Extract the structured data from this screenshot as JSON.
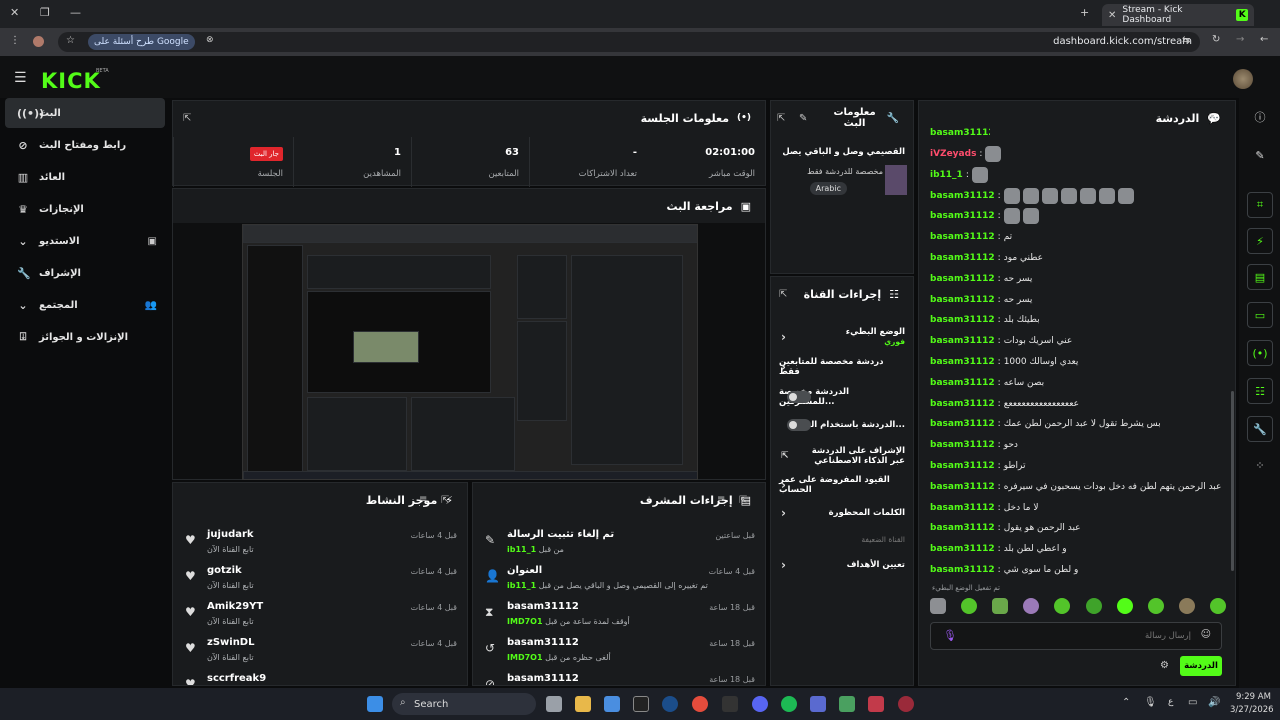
{
  "browser": {
    "tab_title": "Stream - Kick Dashboard",
    "url": "dashboard.kick.com/stream",
    "google_pill": "طرح أسئلة على Google"
  },
  "brand": {
    "logo": "KICK",
    "beta": "BETA"
  },
  "sidebar": {
    "items": [
      {
        "label": "البث",
        "icon": "broadcast-icon"
      },
      {
        "label": "رابط ومفتاح البث",
        "icon": "link-icon"
      },
      {
        "label": "العائد",
        "icon": "chart-icon"
      },
      {
        "label": "الإنجازات",
        "icon": "trophy-icon"
      },
      {
        "label": "الاستديو",
        "icon": "chevron-down-icon"
      },
      {
        "label": "الإشراف",
        "icon": "wrench-icon"
      },
      {
        "label": "المجتمع",
        "icon": "chevron-down-icon"
      },
      {
        "label": "الإنزالات و الجوائز",
        "icon": "gift-icon"
      }
    ]
  },
  "session": {
    "title": "معلومات الجلسة",
    "live_badge": "جار البث",
    "stats": [
      {
        "value": "",
        "label": "الجلسة"
      },
      {
        "value": "1",
        "label": "المشاهدين"
      },
      {
        "value": "63",
        "label": "المتابعين"
      },
      {
        "value": "-",
        "label": "تعداد الاشتراكات"
      },
      {
        "value": "02:01:00",
        "label": "الوقت مباشر"
      }
    ]
  },
  "preview": {
    "title": "مراجعة البث"
  },
  "stream_info": {
    "title": "معلومات البث",
    "stream_title": "القصيمي وصل و الباقي يصل",
    "subtitle": "مخصصة للدردشة فقط",
    "language": "Arabic"
  },
  "channel_actions": {
    "title": "إجراءات القناة",
    "rows": [
      {
        "label": "الوضع البطيء",
        "sub": "فوري"
      },
      {
        "label": "دردشة مخصصة للمتابعين فقط"
      },
      {
        "label": "الدردشة مخصصة للمشتركين...",
        "toggle": true
      },
      {
        "label": "الدردشة باستخدام الصور...",
        "toggle": true
      },
      {
        "label": "الإشراف على الدردشة عبر الذكاء الاصطناعي"
      },
      {
        "label": "القيود المفروضة على عمر الحساب"
      },
      {
        "label": "الكلمات المحظورة"
      },
      {
        "label": "القناة الضعيفة",
        "muted": true
      },
      {
        "label": "تعيين الأهداف"
      }
    ]
  },
  "chat": {
    "title": "الدردشة",
    "send_label": "الدردشة",
    "input_placeholder": "إرسال رسالة",
    "slow_notice": "تم تفعيل الوضع البطيء",
    "messages": [
      {
        "user": "iVZeyads",
        "text": "",
        "emotes": 1,
        "red": true
      },
      {
        "user": "ib11_1",
        "text": "",
        "emotes": 1
      },
      {
        "user": "basam31112",
        "text": "",
        "emotes": 7
      },
      {
        "user": "basam31112",
        "text": "",
        "emotes": 2
      },
      {
        "user": "basam31112",
        "text": "تم"
      },
      {
        "user": "basam31112",
        "text": "عطني مود"
      },
      {
        "user": "basam31112",
        "text": "يسر حه"
      },
      {
        "user": "basam31112",
        "text": "يسر حه"
      },
      {
        "user": "basam31112",
        "text": "بطيئك بلد"
      },
      {
        "user": "basam31112",
        "text": "عني اسريك بودات"
      },
      {
        "user": "basam31112",
        "text": "يعدي اوسالك 1000"
      },
      {
        "user": "basam31112",
        "text": "بصن ساعه"
      },
      {
        "user": "basam31112",
        "text": "ععععععععععععععععع"
      },
      {
        "user": "basam31112",
        "text": "بس يشرط تقول لا عبد الرحمن لطن عمك"
      },
      {
        "user": "basam31112",
        "text": "دحو"
      },
      {
        "user": "basam31112",
        "text": "تراطو"
      },
      {
        "user": "basam31112",
        "text": "عبد الرحمن يتهم لطن فه دخل بودات يسحبون في سيرفره"
      },
      {
        "user": "basam31112",
        "text": "لا ما دخل"
      },
      {
        "user": "basam31112",
        "text": "عبد الرحمن هو يقول"
      },
      {
        "user": "basam31112",
        "text": "و اعطي لطن بلد"
      },
      {
        "user": "basam31112",
        "text": "و لطن ما سوى شي"
      }
    ]
  },
  "mod_actions": {
    "title": "إجراءات المشرف",
    "items": [
      {
        "name": "تم إلغاء تثبيت الرسالة",
        "sub_user": "ib11_1",
        "sub": "من قبل",
        "time": "قبل ساعتين",
        "icon": "unpin-icon"
      },
      {
        "name": "العنوان",
        "sub_user": "ib11_1",
        "sub": "تم تغييره إلى القصيمي وصل و الباقي يصل من قبل",
        "time": "قبل 4 ساعات",
        "icon": "title-icon"
      },
      {
        "name": "basam31112",
        "sub_user": "IMD7O1",
        "sub": "أوقف لمدة ساعة من قبل",
        "time": "قبل 18 ساعة",
        "icon": "hourglass-icon"
      },
      {
        "name": "basam31112",
        "sub_user": "IMD7O1",
        "sub": "ألغى حظره من قبل",
        "time": "قبل 18 ساعة",
        "icon": "undo-icon"
      },
      {
        "name": "basam31112",
        "sub_user": "",
        "sub": "",
        "time": "قبل 18 ساعة",
        "icon": "ban-icon"
      }
    ]
  },
  "activity": {
    "title": "موجز النشاط",
    "items": [
      {
        "name": "jujudark",
        "sub": "تابع القناة الآن",
        "time": "قبل 4 ساعات"
      },
      {
        "name": "gotzik",
        "sub": "تابع القناة الآن",
        "time": "قبل 4 ساعات"
      },
      {
        "name": "Amik29YT",
        "sub": "تابع القناة الآن",
        "time": "قبل 4 ساعات"
      },
      {
        "name": "zSwinDL",
        "sub": "تابع القناة الآن",
        "time": "قبل 4 ساعات"
      },
      {
        "name": "sccrfreak9",
        "sub": "",
        "time": ""
      }
    ]
  },
  "taskbar": {
    "search": "Search",
    "time": "9:29 AM",
    "date": "3/27/2026",
    "lang": "ع"
  }
}
